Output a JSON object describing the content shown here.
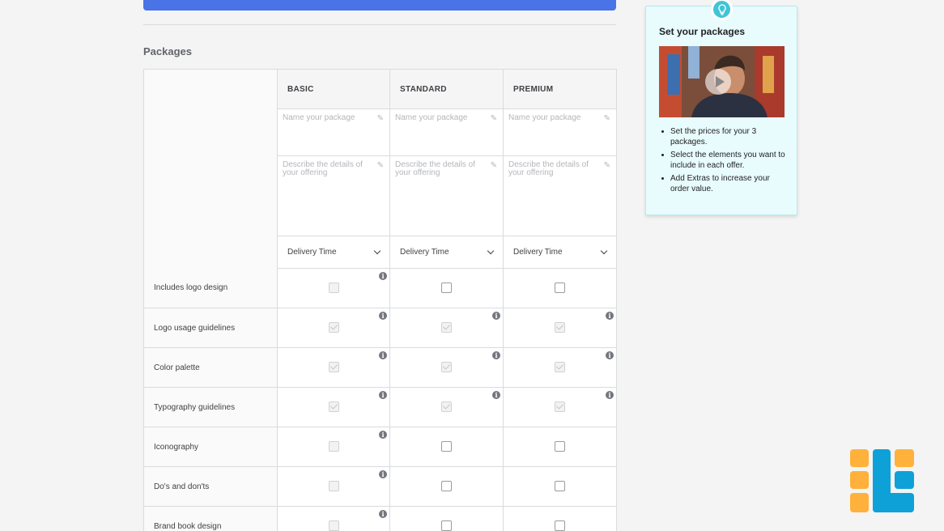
{
  "section_title": "Packages",
  "columns": [
    "BASIC",
    "STANDARD",
    "PREMIUM"
  ],
  "name_placeholder": "Name your package",
  "desc_placeholder": "Describe the details of your offering",
  "delivery_label": "Delivery Time",
  "features": [
    {
      "label": "Includes logo design",
      "cells": [
        "disabled",
        "empty",
        "empty"
      ],
      "info": [
        true,
        false,
        false
      ]
    },
    {
      "label": "Logo usage guidelines",
      "cells": [
        "checked",
        "checked",
        "checked"
      ],
      "info": [
        true,
        true,
        true
      ]
    },
    {
      "label": "Color palette",
      "cells": [
        "checked",
        "checked",
        "checked"
      ],
      "info": [
        true,
        true,
        true
      ]
    },
    {
      "label": "Typography guidelines",
      "cells": [
        "checked",
        "checked",
        "checked"
      ],
      "info": [
        true,
        true,
        true
      ]
    },
    {
      "label": "Iconography",
      "cells": [
        "disabled",
        "empty",
        "empty"
      ],
      "info": [
        true,
        false,
        false
      ]
    },
    {
      "label": "Do's and don'ts",
      "cells": [
        "disabled",
        "empty",
        "empty"
      ],
      "info": [
        true,
        false,
        false
      ]
    },
    {
      "label": "Brand book design",
      "cells": [
        "disabled",
        "empty",
        "empty"
      ],
      "info": [
        true,
        false,
        false
      ]
    }
  ],
  "tip": {
    "title": "Set your packages",
    "bullets": [
      "Set the prices for your 3 packages.",
      "Select the elements you want to include in each offer.",
      "Add Extras to increase your order value."
    ]
  },
  "icons": {
    "info": "info-icon",
    "pencil": "pencil-icon",
    "bulb": "lightbulb-icon",
    "play": "play-icon"
  },
  "colors": {
    "accent_blue": "#4a73e8",
    "tip_bg": "#e8fbfd",
    "tip_badge": "#40c4d6",
    "logo_orange": "#ffb13b",
    "logo_blue": "#0ea1d8"
  }
}
